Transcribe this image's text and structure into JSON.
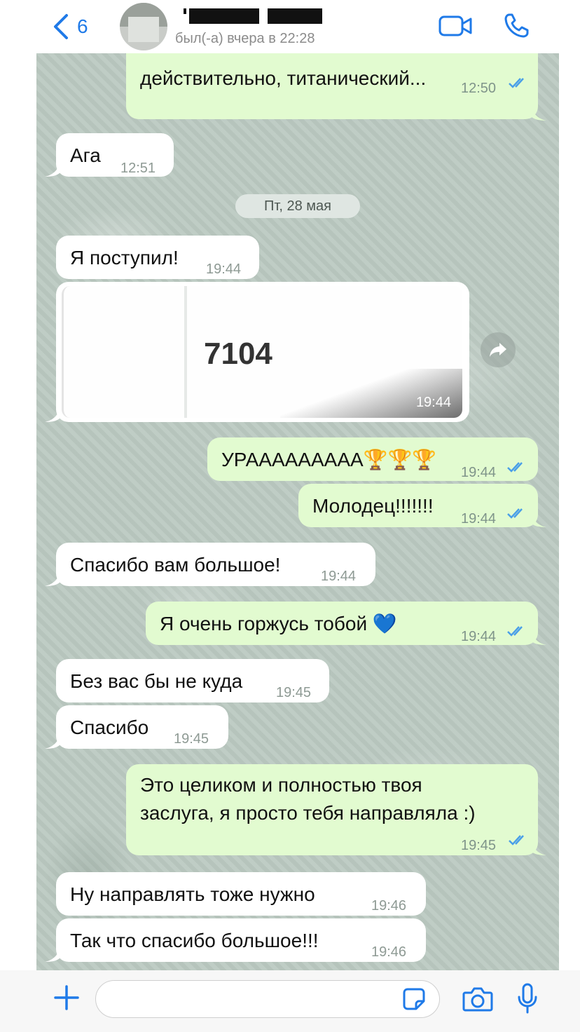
{
  "header": {
    "back_count": "6",
    "last_seen": "был(-а) вчера в 22:28",
    "icons": {
      "back": "chevron-left-icon",
      "video": "video-camera-icon",
      "call": "phone-icon"
    },
    "accent_color": "#1f7ae8"
  },
  "chat": {
    "date_separator": "Пт, 28 мая",
    "messages": [
      {
        "direction": "out",
        "lines": [
          "действительно, титанический..."
        ],
        "time": "12:50",
        "read": true
      },
      {
        "direction": "in",
        "text": "Ага",
        "time": "12:51"
      },
      {
        "direction": "in",
        "text": "Я поступил!",
        "time": "19:44"
      },
      {
        "direction": "in",
        "type": "image",
        "value": "7104",
        "time": "19:44"
      },
      {
        "direction": "out",
        "text": "УРААААААААА🏆🏆🏆",
        "time": "19:44",
        "read": true
      },
      {
        "direction": "out",
        "text": "Молодец!!!!!!!",
        "time": "19:44",
        "read": true
      },
      {
        "direction": "in",
        "text": "Спасибо вам большое!",
        "time": "19:44"
      },
      {
        "direction": "out",
        "text": "Я очень горжусь тобой 💙",
        "time": "19:44",
        "read": true
      },
      {
        "direction": "in",
        "text": "Без вас бы не куда",
        "time": "19:45"
      },
      {
        "direction": "in",
        "text": "Спасибо",
        "time": "19:45"
      },
      {
        "direction": "out",
        "lines": [
          "Это целиком и полностью твоя",
          "заслуга, я просто тебя направляла :)"
        ],
        "time": "19:45",
        "read": true
      },
      {
        "direction": "in",
        "text": "Ну направлять тоже нужно",
        "time": "19:46"
      },
      {
        "direction": "in",
        "text": "Так что спасибо большое!!!",
        "time": "19:46"
      }
    ],
    "colors": {
      "incoming_bubble": "#ffffff",
      "outgoing_bubble": "#e2fbd0",
      "read_ticks": "#4a9fe8",
      "wallpaper": "#bccac2"
    }
  },
  "input_bar": {
    "message_value": "",
    "icons": {
      "attach": "plus-icon",
      "sticker": "sticker-icon",
      "camera": "camera-icon",
      "mic": "microphone-icon"
    }
  }
}
